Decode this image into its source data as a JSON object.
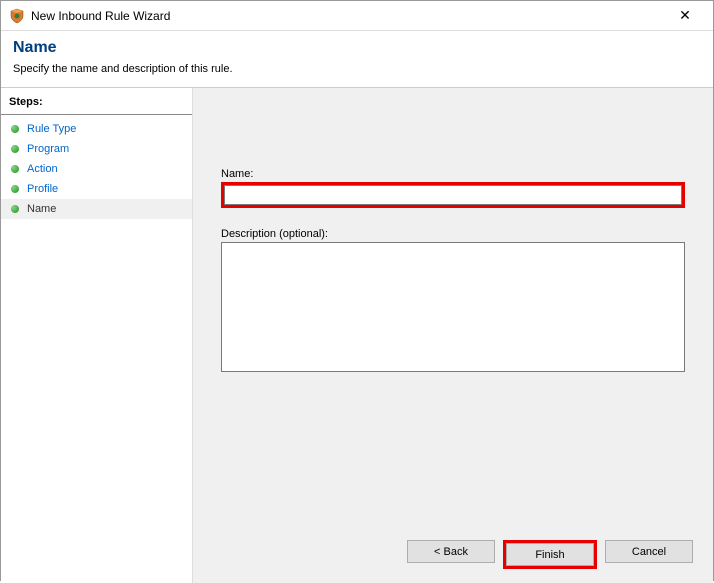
{
  "window": {
    "title": "New Inbound Rule Wizard",
    "close_char": "✕"
  },
  "header": {
    "title": "Name",
    "subtitle": "Specify the name and description of this rule."
  },
  "sidebar": {
    "label": "Steps:",
    "items": [
      {
        "label": "Rule Type",
        "state": "completed"
      },
      {
        "label": "Program",
        "state": "completed"
      },
      {
        "label": "Action",
        "state": "completed"
      },
      {
        "label": "Profile",
        "state": "completed"
      },
      {
        "label": "Name",
        "state": "current"
      }
    ]
  },
  "form": {
    "name_label": "Name:",
    "name_value": "",
    "desc_label": "Description (optional):",
    "desc_value": ""
  },
  "buttons": {
    "back": "< Back",
    "finish": "Finish",
    "cancel": "Cancel"
  },
  "highlights": {
    "name_input": true,
    "finish_button": true,
    "color": "#e60000"
  }
}
